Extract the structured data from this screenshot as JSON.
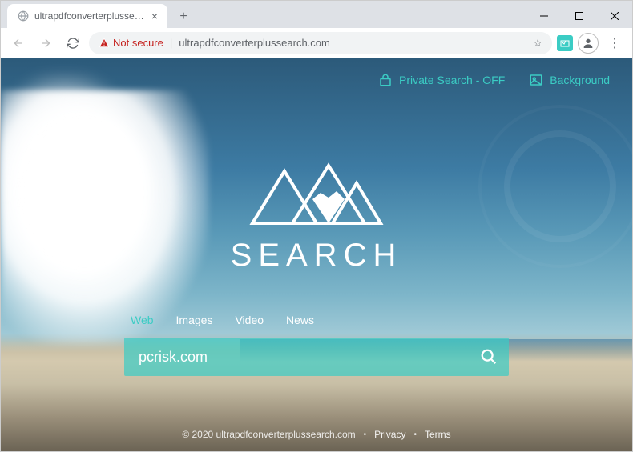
{
  "browser": {
    "tab_title": "ultrapdfconverterplussearch.com",
    "address_warning": "Not secure",
    "address_url": "ultrapdfconverterplussearch.com"
  },
  "topbar": {
    "private_search": "Private Search - OFF",
    "background": "Background"
  },
  "logo": {
    "text": "SEARCH"
  },
  "search_tabs": [
    "Web",
    "Images",
    "Video",
    "News"
  ],
  "search": {
    "value": "pcrisk.com",
    "placeholder": ""
  },
  "footer": {
    "copyright": "© 2020 ultrapdfconverterplussearch.com",
    "privacy": "Privacy",
    "terms": "Terms"
  },
  "colors": {
    "accent": "#3bccc4"
  }
}
